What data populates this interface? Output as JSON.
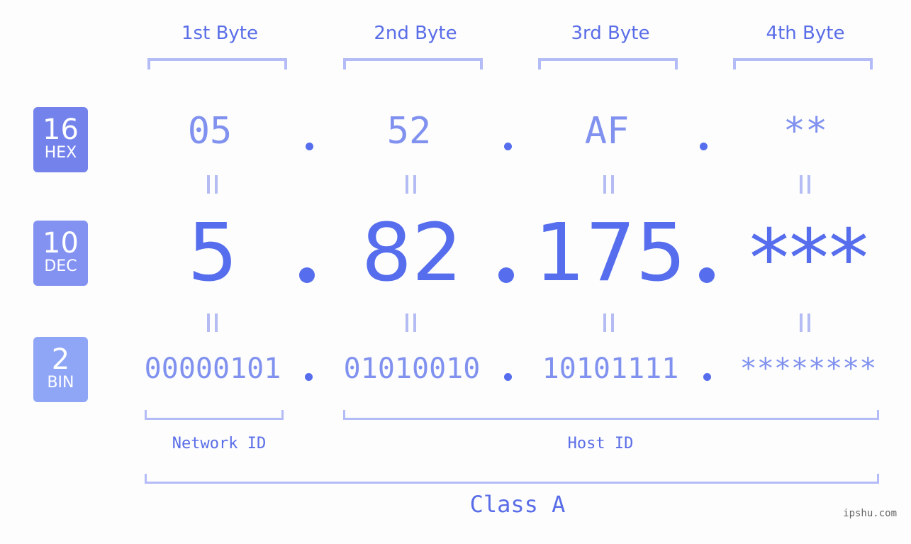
{
  "bytes": [
    {
      "header": "1st Byte",
      "hex": "05",
      "dec": "5",
      "bin": "00000101"
    },
    {
      "header": "2nd Byte",
      "hex": "52",
      "dec": "82",
      "bin": "01010010"
    },
    {
      "header": "3rd Byte",
      "hex": "AF",
      "dec": "175",
      "bin": "10101111"
    },
    {
      "header": "4th Byte",
      "hex": "**",
      "dec": "***",
      "bin": "********"
    }
  ],
  "bases": {
    "hex": {
      "number": "16",
      "label": "HEX",
      "color": "#7483ec"
    },
    "dec": {
      "number": "10",
      "label": "DEC",
      "color": "#8392f1"
    },
    "bin": {
      "number": "2",
      "label": "BIN",
      "color": "#8fa6f7"
    }
  },
  "network_id_label": "Network ID",
  "host_id_label": "Host ID",
  "class_label": "Class A",
  "watermark": "ipshu.com",
  "colors": {
    "accent": "#566ded",
    "light_value": "#8091ef",
    "bracket": "#b4bcf7"
  }
}
